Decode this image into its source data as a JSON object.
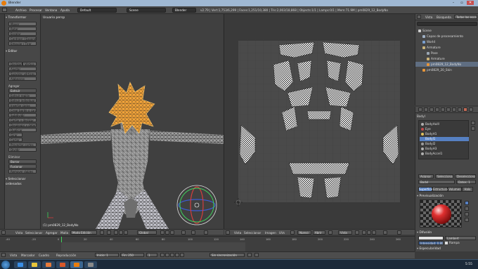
{
  "window": {
    "title": "Blender"
  },
  "info_header": {
    "menus": [
      "Archivo",
      "Procesar",
      "Ventana",
      "Ayuda"
    ],
    "layout": "Default",
    "scene": "Scene",
    "engine": "Blender",
    "stats": "v2.79 | Vert:1,753/6,299 | Faces:1,251/10,380 | Tris:2,003/18,868 | Objects:1/1 | Lamps:0/1 | Mem:71.9M | pm0829_12_BodyNo"
  },
  "toolshelf": {
    "tabs": [
      "Herramientas",
      "Crear",
      "Relaciones",
      "Animación"
    ],
    "sections": [
      {
        "title": "Transformar",
        "items": [
          "Mover",
          "Rotar",
          "Escalar",
          "Contraer / Expandir",
          "Empujar / Tirar"
        ]
      },
      {
        "title": "Editar",
        "items": [
          "Deslizar",
          "Vértice",
          "Ajustar",
          "Suavizar vértices",
          "Alabearse"
        ]
      },
      {
        "title": "Agregar",
        "items": [
          "Extruir",
          "Extruir región",
          "Extruir individual",
          "Insertar caras",
          "Crear borde o cara",
          "Subdividir",
          "Cortar y deslizar",
          "Desplegar y detener",
          "Duplicar",
          "Girar",
          "Cortar",
          "Proyectar cortes",
          "Dividir"
        ]
      },
      {
        "title": "Eliminar",
        "items": [
          "Borrar",
          "Fusionar",
          "Remover dobles"
        ]
      }
    ],
    "extra": "Seleccionar ordenados"
  },
  "viewport": {
    "label": "Usuario persp",
    "object_label": "(1) pm0829_12_BodyNo",
    "header": {
      "menus": [
        "Vista",
        "Seleccionar",
        "Agregar",
        "Malla"
      ],
      "mode": "Modo Edición",
      "pivot": "Global"
    }
  },
  "uv_editor": {
    "header": {
      "menus": [
        "Vista",
        "Seleccionar",
        "Imagen",
        "UVs"
      ],
      "new_btn": "Nuevo",
      "open_btn": "Abrir",
      "view": "Vista"
    }
  },
  "outliner": {
    "header": {
      "menus": [
        "Vista",
        "Búsqueda"
      ],
      "filter": "Todas las escen"
    },
    "rows": [
      {
        "label": "Scene",
        "indent": 0,
        "color": "#cfcfcf"
      },
      {
        "label": "Capas de procesamiento",
        "indent": 1,
        "color": "#9fb0c4"
      },
      {
        "label": "World",
        "indent": 1,
        "color": "#7a9fcf"
      },
      {
        "label": "Armature",
        "indent": 1,
        "color": "#c9b37a"
      },
      {
        "label": "Pose",
        "indent": 2,
        "color": "#9aa6b3"
      },
      {
        "label": "Armature",
        "indent": 2,
        "color": "#c9b37a"
      },
      {
        "label": "pm0829_12_BodyNo",
        "indent": 2,
        "color": "#e8963a",
        "selected": true
      },
      {
        "label": "pm0829_20_Skin",
        "indent": 1,
        "color": "#e8963a"
      }
    ]
  },
  "properties": {
    "object_field": "BodyI",
    "materials": [
      {
        "name": "BodyHulll",
        "color": "#b0b0b0"
      },
      {
        "name": "Eye",
        "color": "#c04a4a"
      },
      {
        "name": "BodyH1",
        "color": "#e0c05c"
      },
      {
        "name": "BodyI1",
        "color": "#5680c2",
        "selected": true
      },
      {
        "name": "BodyI2",
        "color": "#9c9c9c"
      },
      {
        "name": "BodyH3",
        "color": "#b0b0b0"
      },
      {
        "name": "BodyAccel1",
        "color": "#b0b0b0"
      }
    ],
    "actions": [
      "Asignar",
      "Seleccionar",
      "Deseleccionar"
    ],
    "data_field": "BodyI",
    "data_count": "Datos: 1",
    "tabs": [
      "Superficie",
      "Estructura",
      "Volumen",
      "Halo"
    ],
    "preview_label": "Previsualización",
    "diffuse_label": "Difusión",
    "diffuse_shader": "Lambert",
    "intensity": "Intensidad: 0.800",
    "ramp_label": "Rampa",
    "specular_label": "Especularidad"
  },
  "timeline": {
    "ticks": [
      "-40",
      "-20",
      "0",
      "20",
      "40",
      "60",
      "80",
      "100",
      "120",
      "140",
      "160",
      "180",
      "200",
      "220",
      "240",
      "260"
    ],
    "menus": [
      "Vista",
      "Marcador",
      "Cuadro",
      "Reproducción"
    ],
    "start": "Inicio: 1",
    "end": "Fin: 250",
    "current": "1",
    "sync": "Sin sincronización"
  },
  "taskbar": {
    "time": "5:55"
  },
  "colors": {
    "accent": "#5680c2",
    "selection_orange": "#f0a238",
    "header": "#4d4d4d"
  }
}
